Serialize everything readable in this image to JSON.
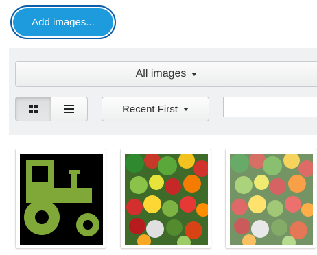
{
  "toolbar": {
    "add_images_label": "Add images..."
  },
  "filter": {
    "all_images_label": "All images",
    "sort_label": "Recent First",
    "search_placeholder": "",
    "search_value": ""
  },
  "view_modes": [
    {
      "icon": "grid-icon",
      "active": true
    },
    {
      "icon": "list-icon",
      "active": false
    }
  ],
  "thumbnails": [
    {
      "icon": "tractor-image",
      "background": "#000000",
      "color": "#7fa838"
    },
    {
      "icon": "vegetables-image"
    },
    {
      "icon": "vegetables-faded-image"
    }
  ],
  "colors": {
    "accent": "#1d9bdc",
    "accent_border": "#0d5ea8",
    "panel": "#f0f1f2"
  }
}
